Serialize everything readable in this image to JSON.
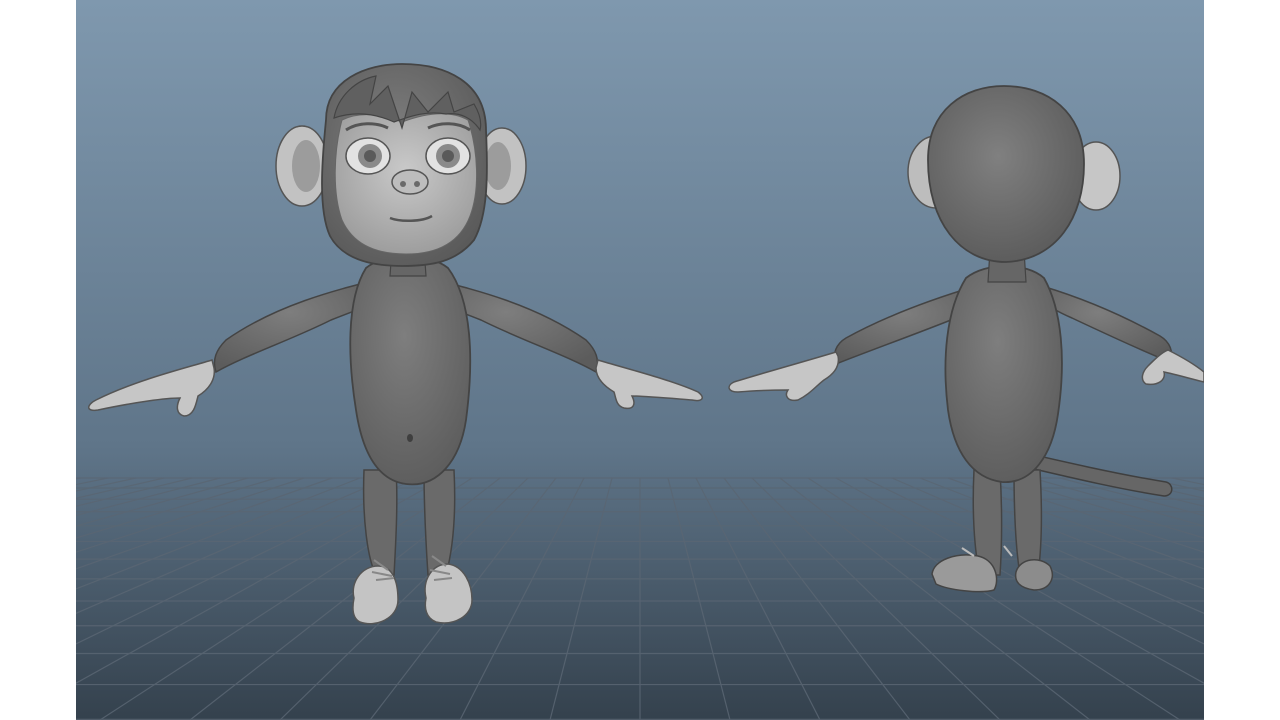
{
  "viewport": {
    "background_top": "#7f98ae",
    "background_horizon": "#5d7389",
    "background_bottom": "#3a4a5a",
    "grid_color": "#55626f",
    "model_color": "#6f6f6f",
    "model_light": "#b9b9b9",
    "shoe_color": "#c8c8c8"
  },
  "models": [
    {
      "name": "monkey-front-view",
      "kind": "front"
    },
    {
      "name": "monkey-back-view",
      "kind": "back"
    }
  ]
}
